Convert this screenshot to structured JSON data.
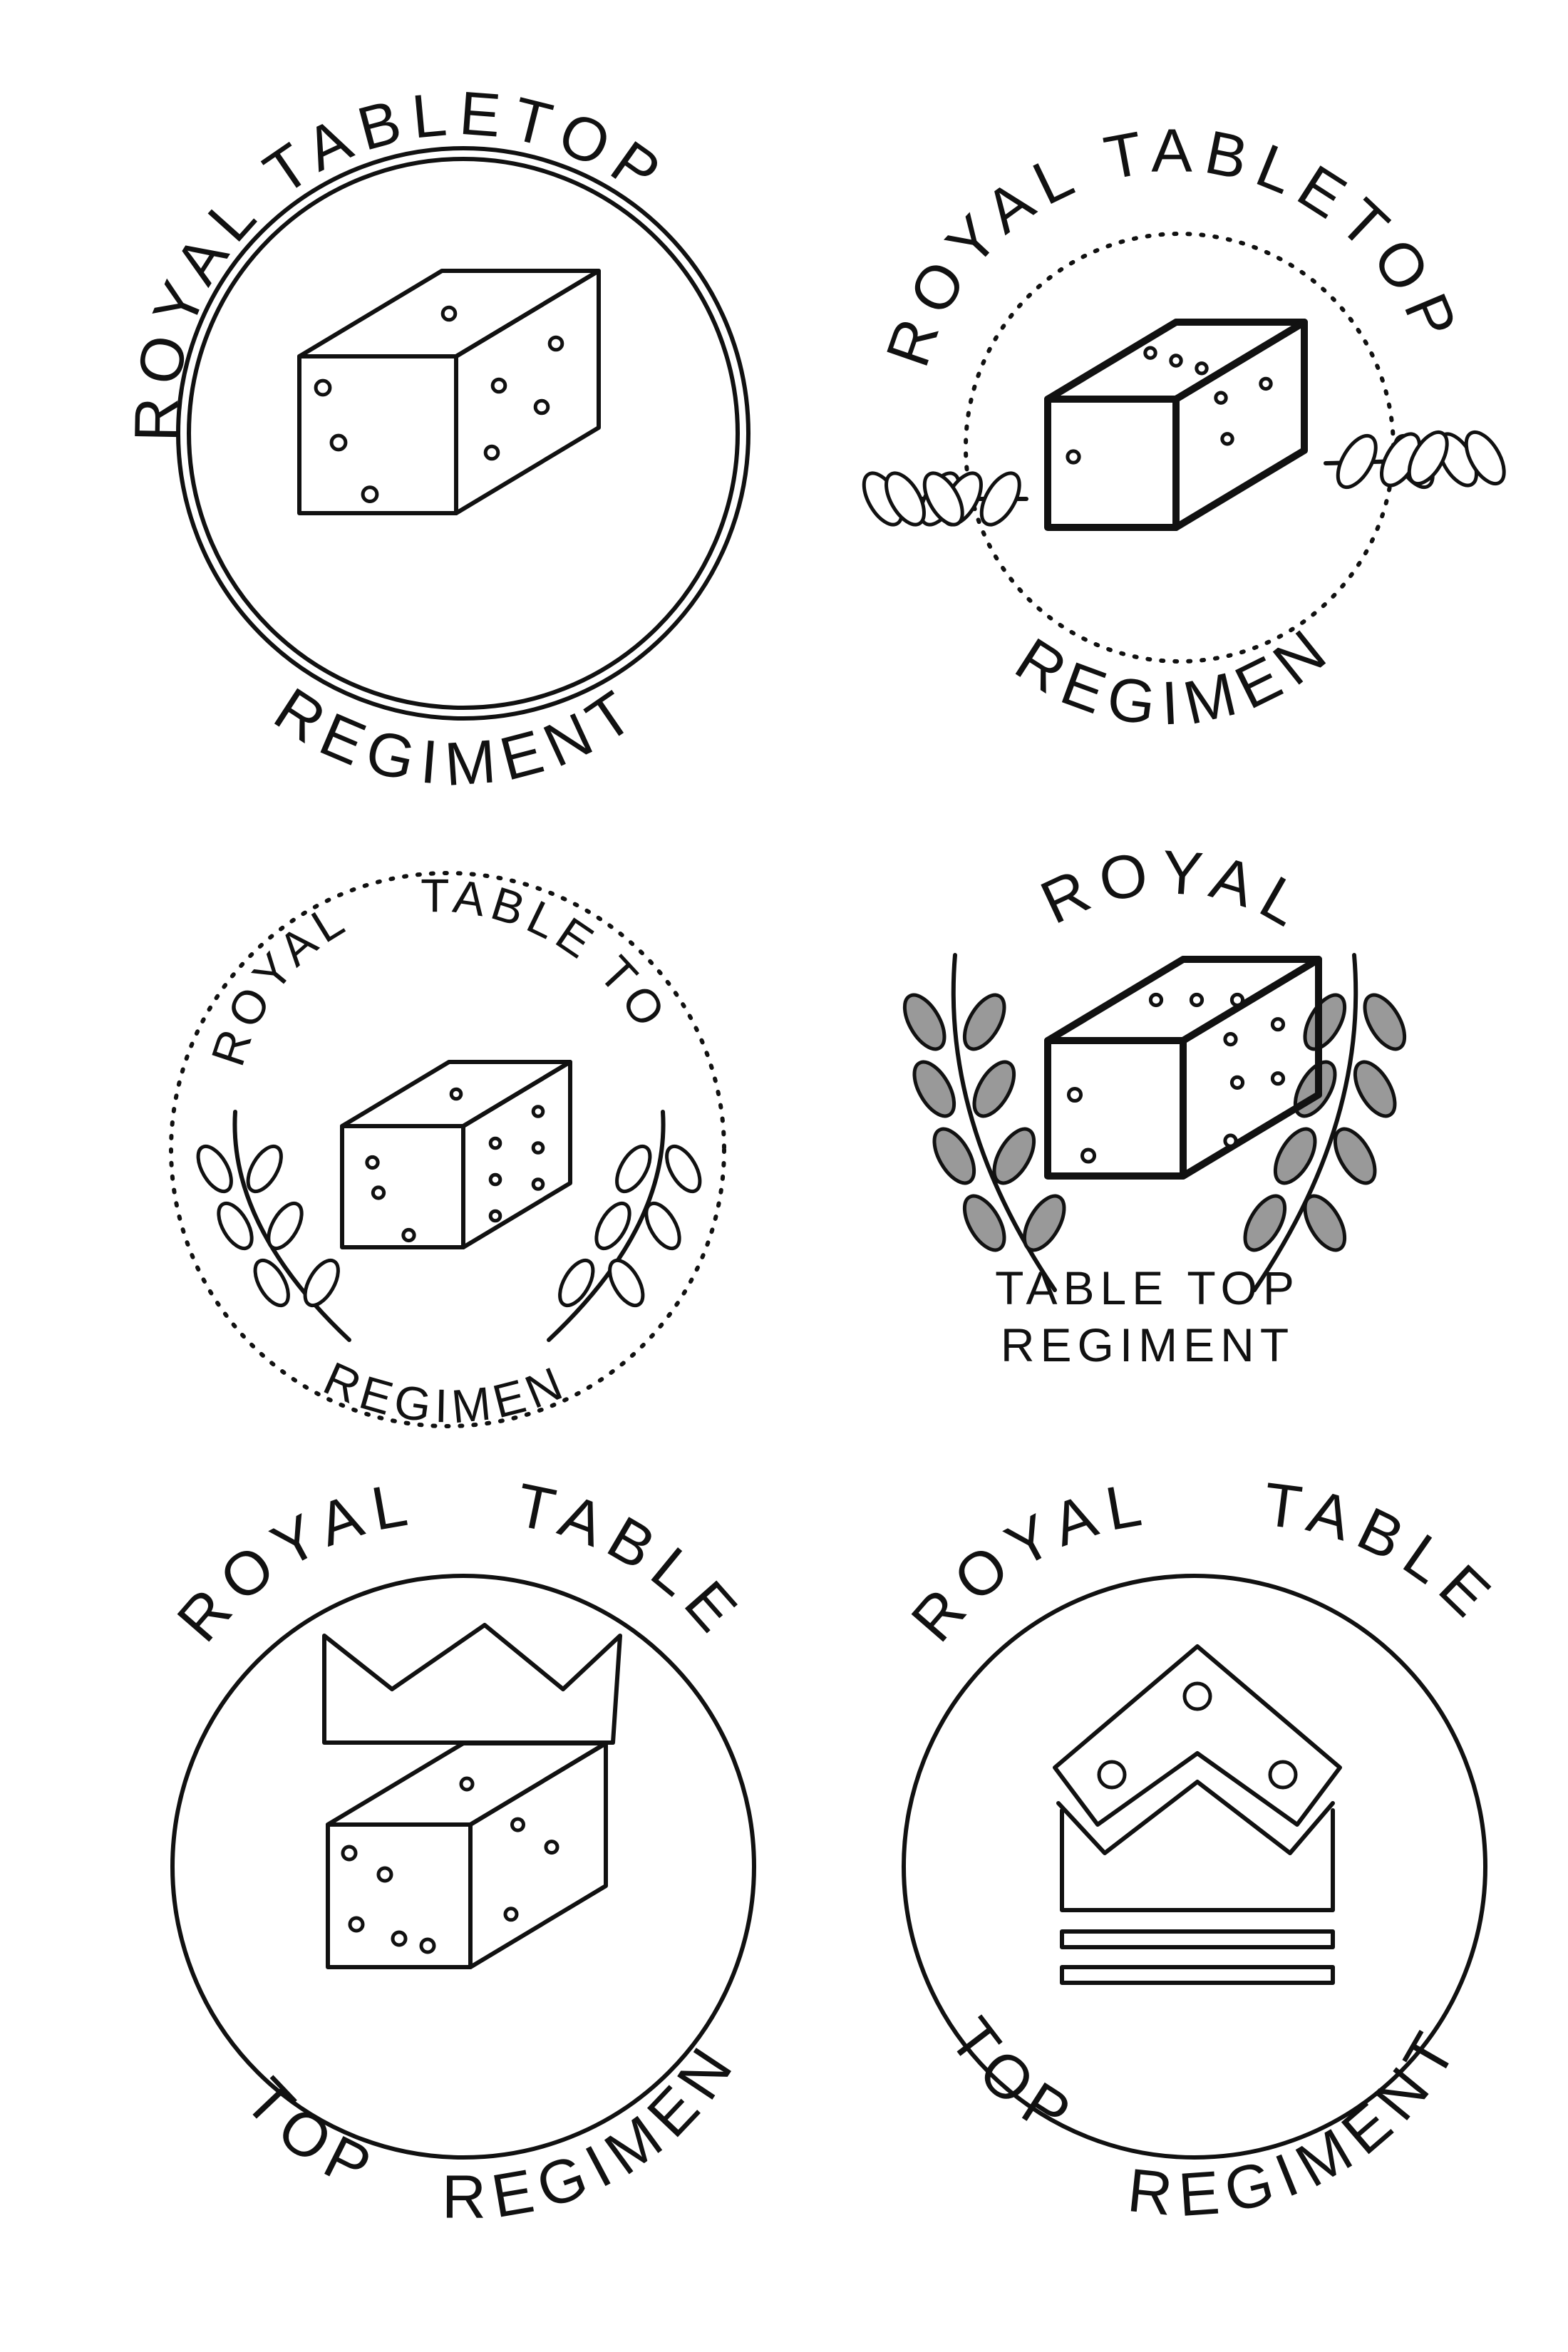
{
  "sketches": [
    {
      "top": "ROYAL TABLETOP",
      "bottom": "REGIMENT",
      "emblem": "dice",
      "frame": "double-circle"
    },
    {
      "top": "ROYAL TABLETOP",
      "bottom": "REGIMENT",
      "emblem": "dice",
      "frame": "dashed-arc-with-leaves"
    },
    {
      "top_left": "ROYAL",
      "top_right": "TABLE TOP",
      "bottom": "REGIMENT",
      "emblem": "dice",
      "frame": "dotted-circle-with-laurels"
    },
    {
      "top": "ROYAL",
      "bottom_line1": "TABLE TOP",
      "bottom_line2": "REGIMENT",
      "emblem": "dice",
      "frame": "shaded-laurel"
    },
    {
      "top_left": "ROYAL",
      "top_right": "TABLE",
      "bottom_left": "TOP",
      "bottom_right": "REGIMENT",
      "emblem": "crown-over-dice",
      "frame": "circle"
    },
    {
      "top_left": "ROYAL",
      "top_right": "TABLE",
      "bottom_left": "TOP",
      "bottom_right": "REGIMENT",
      "emblem": "dice-crown",
      "frame": "circle"
    }
  ],
  "colors": {
    "ink": "#111111",
    "paper": "#ffffff",
    "shade": "#999999"
  }
}
